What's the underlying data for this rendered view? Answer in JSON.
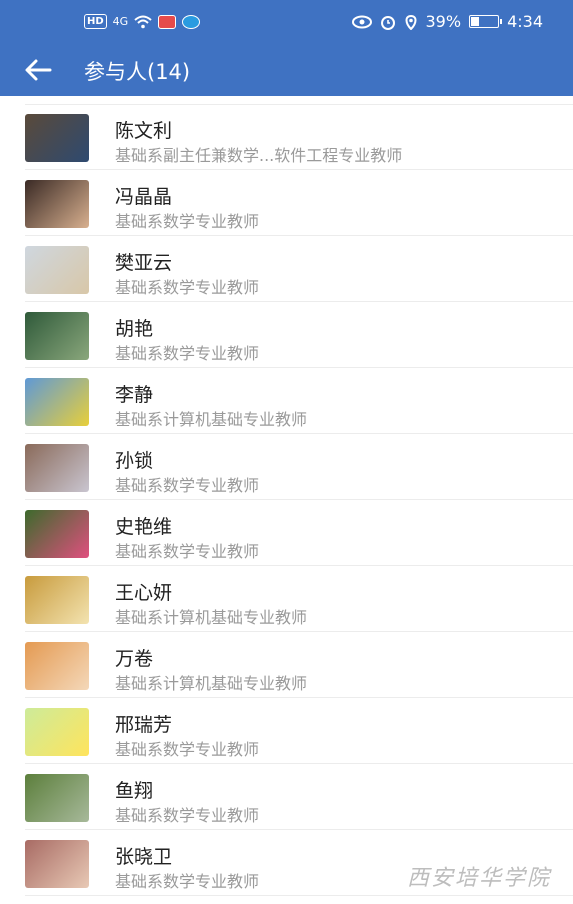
{
  "status_bar": {
    "left": [
      "HD",
      "4G"
    ],
    "battery": "39%",
    "time": "4:34"
  },
  "header": {
    "title": "参与人(14)"
  },
  "participants": [
    {
      "name": "陈文利",
      "desc": "基础系副主任兼数学...软件工程专业教师",
      "avatar": [
        "#5a4a3a",
        "#2e4a70"
      ]
    },
    {
      "name": "冯晶晶",
      "desc": "基础系数学专业教师",
      "avatar": [
        "#3a2a25",
        "#d8b08f"
      ]
    },
    {
      "name": "樊亚云",
      "desc": "基础系数学专业教师",
      "avatar": [
        "#cfd7df",
        "#d8c7a8"
      ]
    },
    {
      "name": "胡艳",
      "desc": "基础系数学专业教师",
      "avatar": [
        "#2f5a3a",
        "#8aa77c"
      ]
    },
    {
      "name": "李静",
      "desc": "基础系计算机基础专业教师",
      "avatar": [
        "#5f99d6",
        "#e8cf3a"
      ]
    },
    {
      "name": "孙锁",
      "desc": "基础系数学专业教师",
      "avatar": [
        "#8a6a5a",
        "#c9c5d0"
      ]
    },
    {
      "name": "史艳维",
      "desc": "基础系数学专业教师",
      "avatar": [
        "#3d6a2c",
        "#e0507f"
      ]
    },
    {
      "name": "王心妍",
      "desc": "基础系计算机基础专业教师",
      "avatar": [
        "#c89b3d",
        "#f3e3b0"
      ]
    },
    {
      "name": "万卷",
      "desc": "基础系计算机基础专业教师",
      "avatar": [
        "#e49a52",
        "#f4d8b9"
      ]
    },
    {
      "name": "邢瑞芳",
      "desc": "基础系数学专业教师",
      "avatar": [
        "#cdeb9a",
        "#ffe45c"
      ]
    },
    {
      "name": "鱼翔",
      "desc": "基础系数学专业教师",
      "avatar": [
        "#5c7f3c",
        "#a7b99a"
      ]
    },
    {
      "name": "张晓卫",
      "desc": "基础系数学专业教师",
      "avatar": [
        "#a86b64",
        "#e8c9b5"
      ]
    }
  ],
  "watermark": "西安培华学院"
}
